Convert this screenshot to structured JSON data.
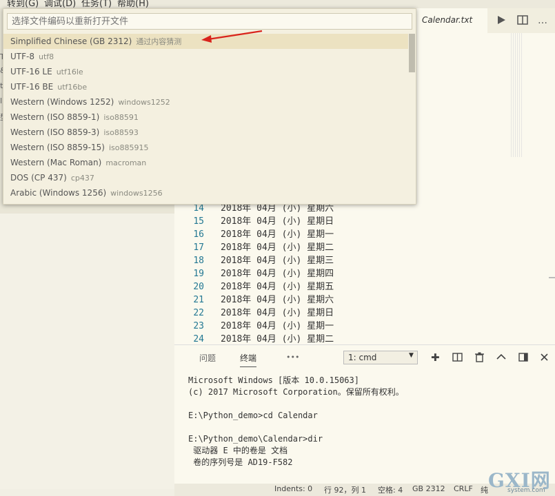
{
  "menubar": {
    "items": [
      "转到(G)",
      "调试(D)",
      "任务(T)",
      "帮助(H)"
    ]
  },
  "sidebar": {
    "letters": [
      "T",
      "&",
      "t",
      "l",
      "型"
    ]
  },
  "editor": {
    "tab_title": "Calendar.txt",
    "lines": [
      {
        "num": "14",
        "text": "2018年 04月 (小) 星期六"
      },
      {
        "num": "15",
        "text": "2018年 04月 (小) 星期日"
      },
      {
        "num": "16",
        "text": "2018年 04月 (小) 星期一"
      },
      {
        "num": "17",
        "text": "2018年 04月 (小) 星期二"
      },
      {
        "num": "18",
        "text": "2018年 04月 (小) 星期三"
      },
      {
        "num": "19",
        "text": "2018年 04月 (小) 星期四"
      },
      {
        "num": "20",
        "text": "2018年 04月 (小) 星期五"
      },
      {
        "num": "21",
        "text": "2018年 04月 (小) 星期六"
      },
      {
        "num": "22",
        "text": "2018年 04月 (小) 星期日"
      },
      {
        "num": "23",
        "text": "2018年 04月 (小) 星期一"
      },
      {
        "num": "24",
        "text": "2018年 04月 (小) 星期二"
      }
    ]
  },
  "quickpick": {
    "placeholder": "选择文件编码以重新打开文件",
    "items": [
      {
        "label": "Simplified Chinese (GB 2312)",
        "desc": "通过内容猜测"
      },
      {
        "label": "UTF-8",
        "desc": "utf8"
      },
      {
        "label": "UTF-16 LE",
        "desc": "utf16le"
      },
      {
        "label": "UTF-16 BE",
        "desc": "utf16be"
      },
      {
        "label": "Western (Windows 1252)",
        "desc": "windows1252"
      },
      {
        "label": "Western (ISO 8859-1)",
        "desc": "iso88591"
      },
      {
        "label": "Western (ISO 8859-3)",
        "desc": "iso88593"
      },
      {
        "label": "Western (ISO 8859-15)",
        "desc": "iso885915"
      },
      {
        "label": "Western (Mac Roman)",
        "desc": "macroman"
      },
      {
        "label": "DOS (CP 437)",
        "desc": "cp437"
      },
      {
        "label": "Arabic (Windows 1256)",
        "desc": "windows1256"
      }
    ]
  },
  "panel": {
    "tabs": [
      "问题",
      "终端"
    ],
    "more": "•••",
    "terminal_select": "1: cmd",
    "terminal_lines": [
      "Microsoft Windows [版本 10.0.15063]",
      "(c) 2017 Microsoft Corporation。保留所有权利。",
      "",
      "E:\\Python_demo>cd Calendar",
      "",
      "E:\\Python_demo\\Calendar>dir",
      " 驱动器 E 中的卷是 文档",
      " 卷的序列号是 AD19-F582"
    ]
  },
  "statusbar": {
    "indents": "Indents: 0",
    "position": "行 92，列 1",
    "spaces": "空格: 4",
    "encoding": "GB 2312",
    "eol": "CRLF",
    "lang": "纯"
  },
  "watermark": {
    "text": "GXI网",
    "sub": "system.com"
  },
  "colors": {
    "selected_bg": "#ece2c1",
    "arrow": "#d9241c",
    "line_number": "#237893"
  }
}
